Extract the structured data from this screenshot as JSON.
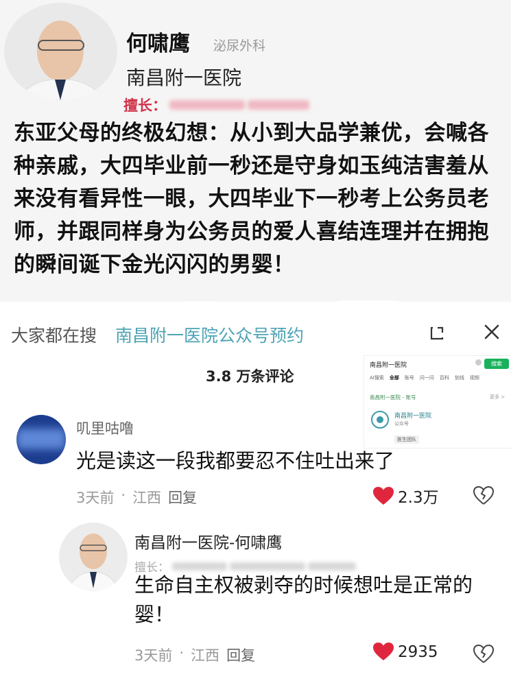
{
  "post": {
    "author_name": "何啸鹰",
    "department": "泌尿外科",
    "hospital": "南昌附一医院",
    "specialty_label": "擅长：",
    "body": "东亚父母的终极幻想：从小到大品学兼优，会喊各种亲戚，大四毕业前一秒还是守身如玉纯洁害羞从来没有看异性一眼，大四毕业下一秒考上公务员老师，并跟同样身为公务员的爱人喜结连理并在拥抱的瞬间诞下金光闪闪的男婴！"
  },
  "search_bar": {
    "prefix": "大家都在搜",
    "query": "南昌附一医院公众号预约"
  },
  "comments_header": {
    "count": "3.8 万条评论"
  },
  "inset": {
    "query": "南昌附一医院",
    "search_button": "搜索",
    "tabs": [
      "AI搜索",
      "全部",
      "账号",
      "问一问",
      "百科",
      "划线",
      "视频"
    ],
    "section": "南昌附一医院 - 账号",
    "more": "更多 >",
    "account_name": "南昌附一医院",
    "account_type": "公众号",
    "account_tag": "医生团队"
  },
  "comments": [
    {
      "user": "叽里咕噜",
      "text": "光是读这一段我都要忍不住吐出来了",
      "time": "3天前",
      "location": "江西",
      "reply_label": "回复",
      "likes": "2.3万"
    },
    {
      "user": "南昌附一医院-何啸鹰",
      "specialty_label": "擅长：",
      "text": "生命自主权被剥夺的时候想吐是正常的婴！",
      "time": "3天前",
      "location": "江西",
      "reply_label": "回复",
      "likes": "2935"
    }
  ],
  "colors": {
    "accent": "#4da3b4",
    "like_red": "#e0263e",
    "specialty_red": "#d2334a"
  }
}
